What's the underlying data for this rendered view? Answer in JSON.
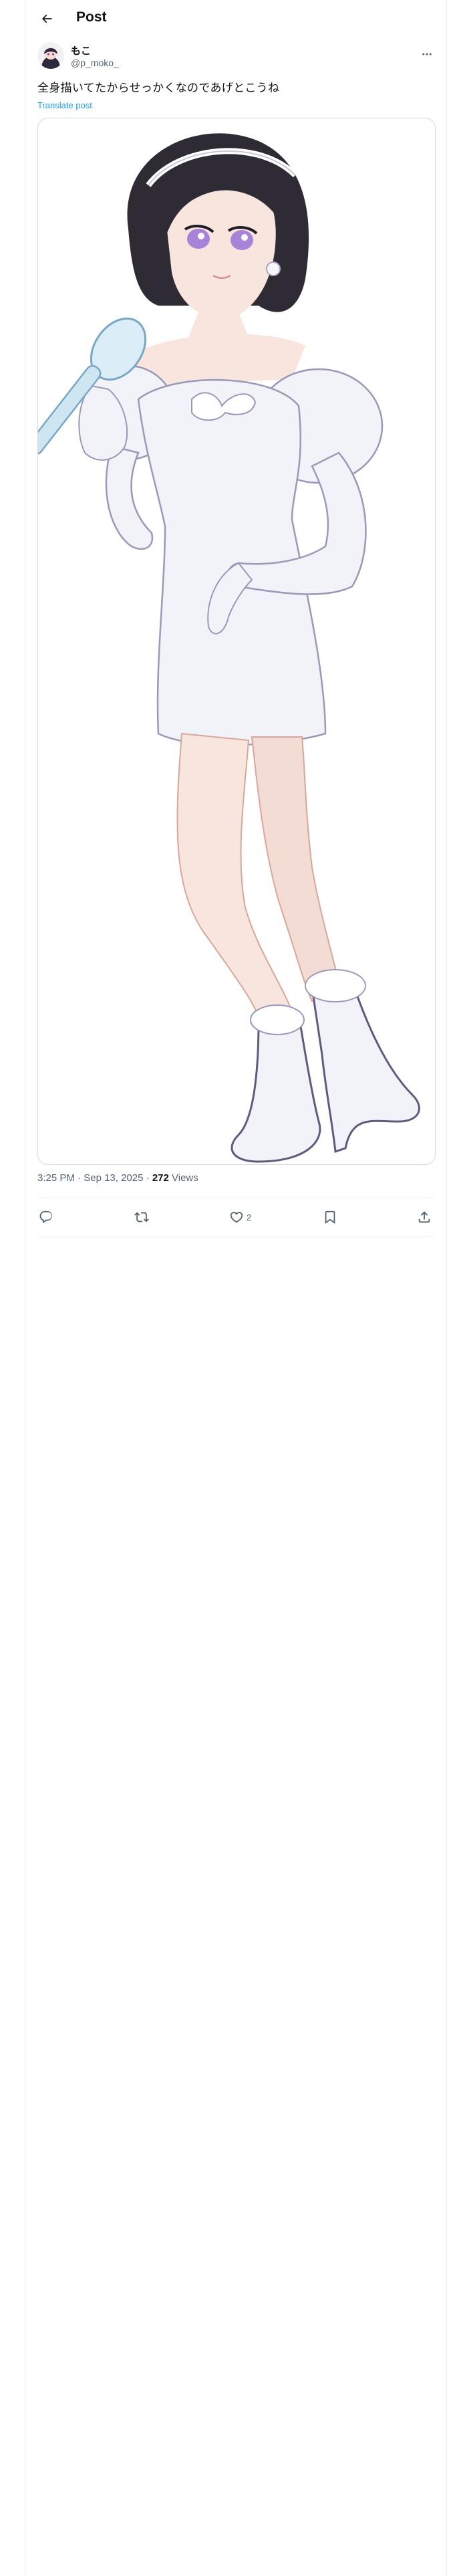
{
  "header": {
    "title": "Post"
  },
  "author": {
    "name": "もこ",
    "handle": "@p_moko_"
  },
  "post": {
    "text": "全身描いてたからせっかくなのであげとこうね",
    "translate_label": "Translate post",
    "media_alt": "Illustration of a girl in a white puff-sleeve dress with gloves and boots holding a hand mirror"
  },
  "meta": {
    "time": "3:25 PM",
    "separator": " · ",
    "date": "Sep 13, 2025",
    "views_count": "272",
    "views_label": "Views"
  },
  "actions": {
    "reply_count": "",
    "repost_count": "",
    "like_count": "2",
    "bookmark_count": ""
  },
  "colors": {
    "accent": "#1d9bf0",
    "text": "#0f1419",
    "secondary": "#536471",
    "border": "#eff3f4"
  }
}
